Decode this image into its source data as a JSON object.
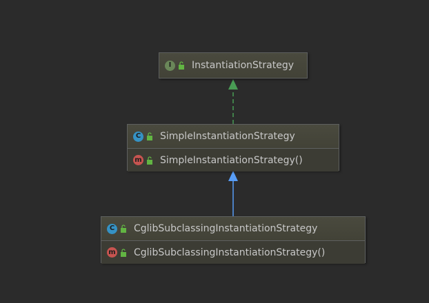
{
  "colors": {
    "background": "#2b2b2b",
    "interface_badge": "#6a8759",
    "class_badge": "#3592c4",
    "method_badge": "#c75450",
    "lock_icon": "#62b543",
    "implements_arrow": "#499c54",
    "extends_arrow": "#589df6"
  },
  "nodes": {
    "instantiation_strategy": {
      "kind": "interface",
      "badge": "I",
      "icon": "interface-icon",
      "name": "InstantiationStrategy",
      "members": []
    },
    "simple_instantiation_strategy": {
      "kind": "class",
      "badge": "C",
      "icon": "class-icon",
      "name": "SimpleInstantiationStrategy",
      "members": [
        {
          "badge": "m",
          "icon": "method-icon",
          "name": "SimpleInstantiationStrategy()"
        }
      ]
    },
    "cglib_subclassing_instantiation_strategy": {
      "kind": "class",
      "badge": "C",
      "icon": "class-icon",
      "name": "CglibSubclassingInstantiationStrategy",
      "members": [
        {
          "badge": "m",
          "icon": "method-icon",
          "name": "CglibSubclassingInstantiationStrategy()"
        }
      ]
    }
  },
  "edges": [
    {
      "from": "simple_instantiation_strategy",
      "to": "instantiation_strategy",
      "type": "implements",
      "style": "dashed"
    },
    {
      "from": "cglib_subclassing_instantiation_strategy",
      "to": "simple_instantiation_strategy",
      "type": "extends",
      "style": "solid"
    }
  ]
}
